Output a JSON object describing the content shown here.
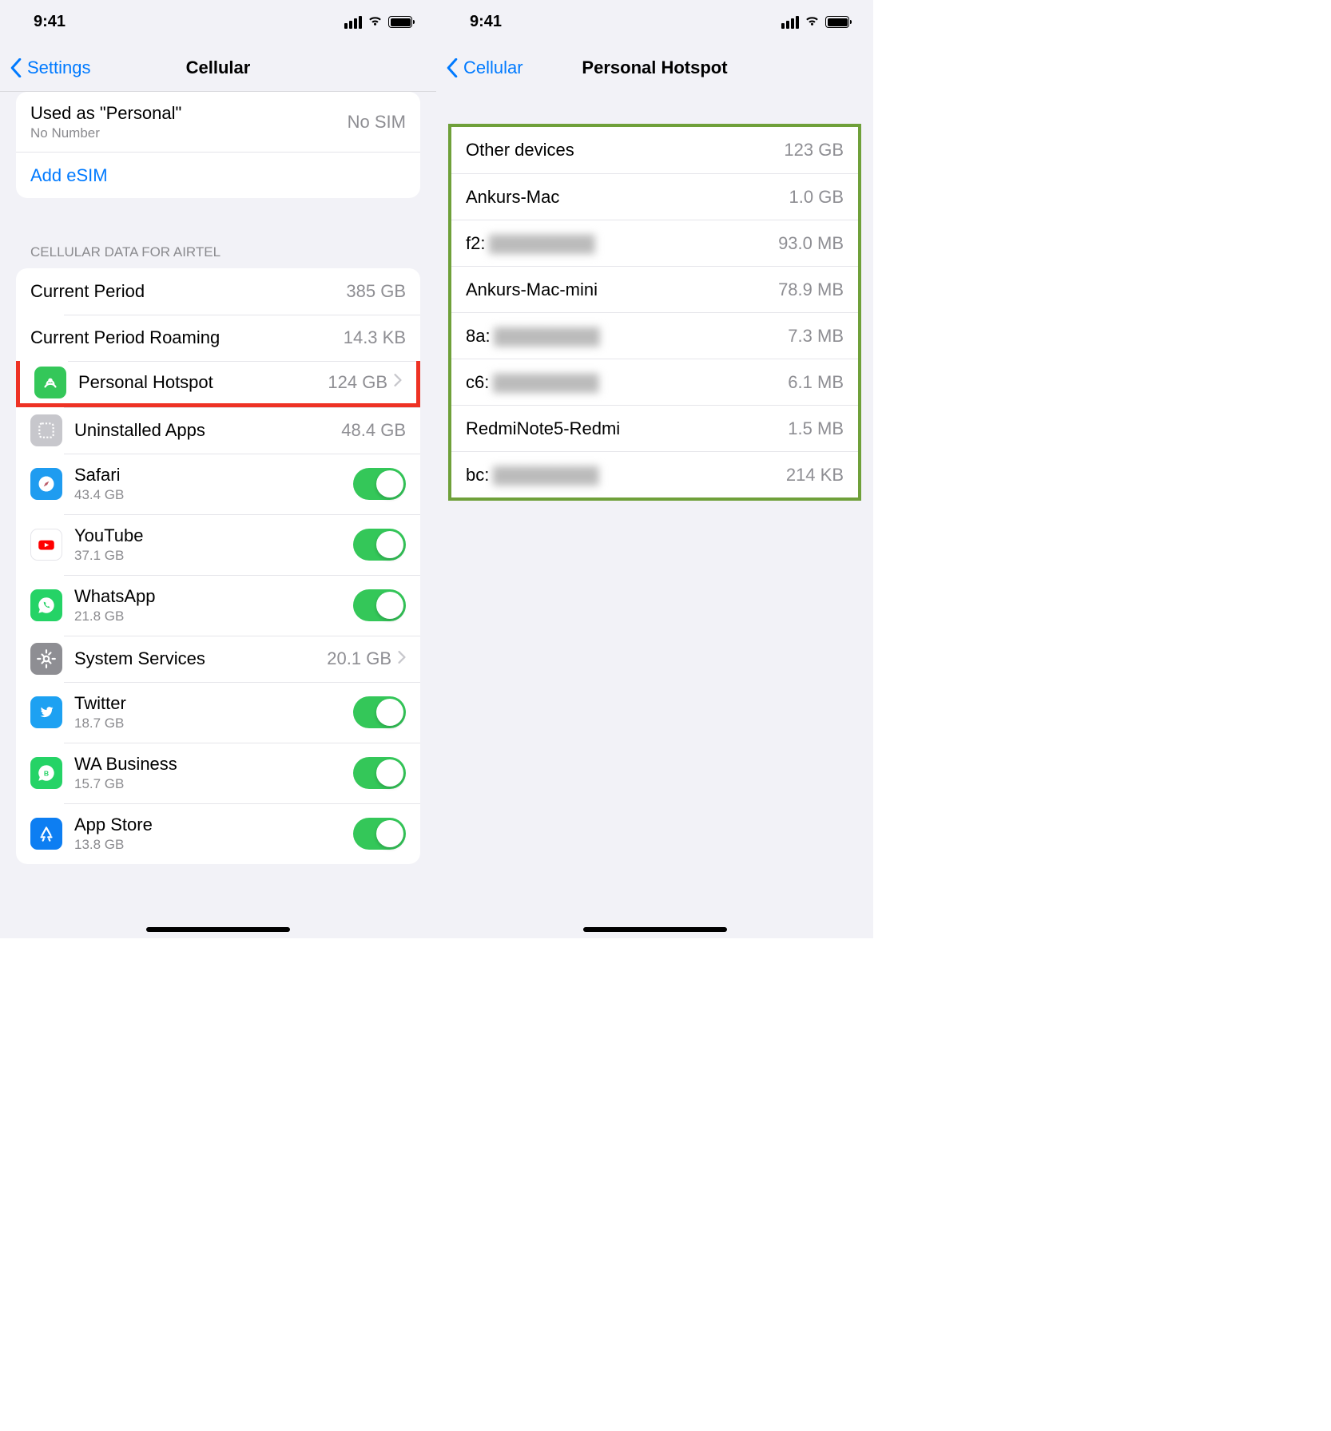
{
  "status": {
    "time": "9:41"
  },
  "left": {
    "back_label": "Settings",
    "title": "Cellular",
    "sim": {
      "used_as": "Used as \"Personal\"",
      "no_number": "No Number",
      "status": "No SIM",
      "add_esim": "Add eSIM"
    },
    "group2_header": "CELLULAR DATA FOR AIRTEL",
    "rows": {
      "current_period": {
        "label": "Current Period",
        "value": "385 GB"
      },
      "current_roaming": {
        "label": "Current Period Roaming",
        "value": "14.3 KB"
      },
      "personal_hotspot": {
        "label": "Personal Hotspot",
        "value": "124 GB"
      },
      "uninstalled": {
        "label": "Uninstalled Apps",
        "value": "48.4 GB"
      },
      "safari": {
        "label": "Safari",
        "sub": "43.4 GB"
      },
      "youtube": {
        "label": "YouTube",
        "sub": "37.1 GB"
      },
      "whatsapp": {
        "label": "WhatsApp",
        "sub": "21.8 GB"
      },
      "system": {
        "label": "System Services",
        "value": "20.1 GB"
      },
      "twitter": {
        "label": "Twitter",
        "sub": "18.7 GB"
      },
      "wabusiness": {
        "label": "WA Business",
        "sub": "15.7 GB"
      },
      "appstore": {
        "label": "App Store",
        "sub": "13.8 GB"
      }
    }
  },
  "right": {
    "back_label": "Cellular",
    "title": "Personal Hotspot",
    "rows": [
      {
        "label": "Other devices",
        "value": "123 GB"
      },
      {
        "label": "Ankurs-Mac",
        "value": "1.0 GB"
      },
      {
        "label": "f2:",
        "value": "93.0 MB",
        "blur": true
      },
      {
        "label": "Ankurs-Mac-mini",
        "value": "78.9 MB"
      },
      {
        "label": "8a:",
        "value": "7.3 MB",
        "blur": true
      },
      {
        "label": "c6:",
        "value": "6.1 MB",
        "blur": true
      },
      {
        "label": "RedmiNote5-Redmi",
        "value": "1.5 MB"
      },
      {
        "label": "bc:",
        "value": "214 KB",
        "blur": true
      }
    ]
  }
}
